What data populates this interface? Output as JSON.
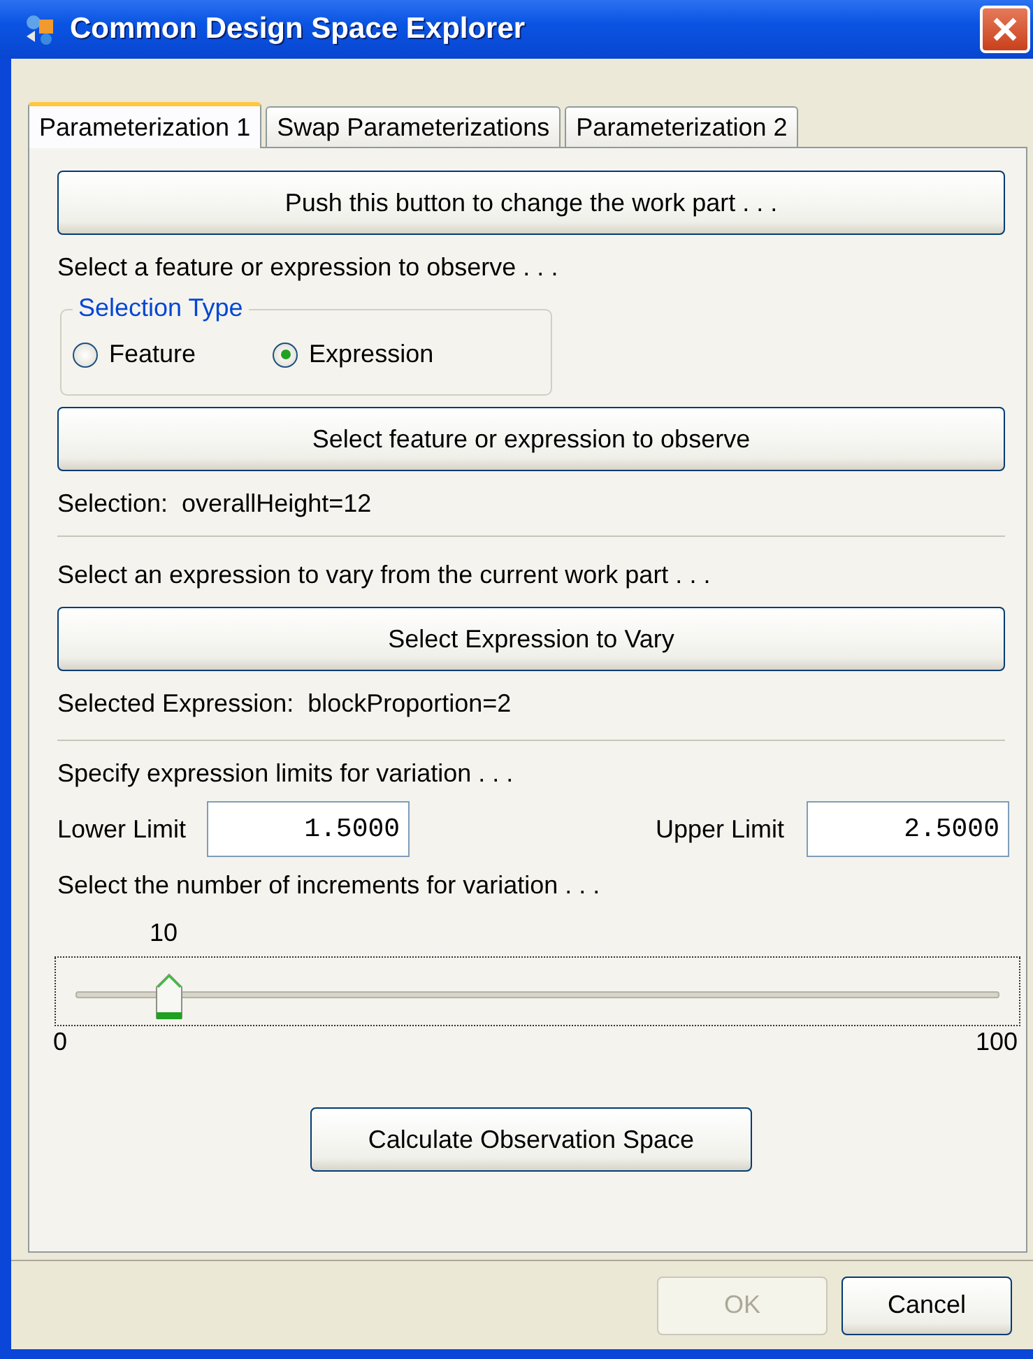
{
  "window": {
    "title": "Common Design Space Explorer"
  },
  "tabs": [
    {
      "label": "Parameterization 1",
      "selected": true
    },
    {
      "label": "Swap Parameterizations",
      "selected": false
    },
    {
      "label": "Parameterization 2",
      "selected": false
    }
  ],
  "work_part_button": "Push this button to change the work part . . .",
  "observe_prompt": "Select a feature or expression to observe . . .",
  "selection_type": {
    "legend": "Selection Type",
    "options": [
      {
        "label": "Feature",
        "selected": false
      },
      {
        "label": "Expression",
        "selected": true
      }
    ]
  },
  "observe_button": "Select feature or expression to observe",
  "selection": "Selection:  overallHeight=12",
  "vary_prompt": "Select an expression to vary from the current work part . . .",
  "vary_button": "Select Expression to Vary",
  "selected_expression": "Selected Expression:  blockProportion=2",
  "limits_prompt": "Specify expression limits for variation . . .",
  "lower_limit": {
    "label": "Lower Limit",
    "value": "1.5000"
  },
  "upper_limit": {
    "label": "Upper Limit",
    "value": "2.5000"
  },
  "increments_prompt": "Select the number of increments for variation . . .",
  "increments_slider": {
    "reading": "10",
    "level": 0.1,
    "min_label": "0",
    "max_label": "100"
  },
  "calculate_button": "Calculate Observation Space",
  "buttons": [
    {
      "label": "OK",
      "disabled": true
    },
    {
      "label": "Cancel",
      "disabled": false
    }
  ]
}
